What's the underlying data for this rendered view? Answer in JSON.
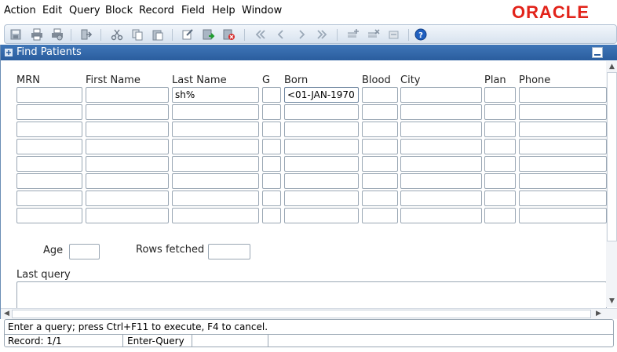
{
  "menu": [
    "Action",
    "Edit",
    "Query",
    "Block",
    "Record",
    "Field",
    "Help",
    "Window"
  ],
  "brand": "ORACLE",
  "brand_color": "#e2231a",
  "toolbar": {
    "icons": [
      "save-icon",
      "print-icon",
      "print-setup-icon",
      "exit-icon",
      "cut-icon",
      "copy-icon",
      "paste-icon",
      "enter-query-icon",
      "execute-query-icon",
      "cancel-query-icon",
      "first-record-icon",
      "previous-record-icon",
      "next-record-icon",
      "last-record-icon",
      "insert-record-icon",
      "delete-record-icon",
      "clear-record-icon",
      "help-icon"
    ]
  },
  "window": {
    "title": "Find Patients",
    "columns": [
      "MRN",
      "First Name",
      "Last Name",
      "G",
      "Born",
      "Blood",
      "City",
      "Plan",
      "Phone"
    ],
    "rows": [
      [
        "",
        "",
        "sh%",
        "",
        "<01-JAN-1970",
        "",
        "",
        "",
        ""
      ],
      [
        "",
        "",
        "",
        "",
        "",
        "",
        "",
        "",
        ""
      ],
      [
        "",
        "",
        "",
        "",
        "",
        "",
        "",
        "",
        ""
      ],
      [
        "",
        "",
        "",
        "",
        "",
        "",
        "",
        "",
        ""
      ],
      [
        "",
        "",
        "",
        "",
        "",
        "",
        "",
        "",
        ""
      ],
      [
        "",
        "",
        "",
        "",
        "",
        "",
        "",
        "",
        ""
      ],
      [
        "",
        "",
        "",
        "",
        "",
        "",
        "",
        "",
        ""
      ],
      [
        "",
        "",
        "",
        "",
        "",
        "",
        "",
        "",
        ""
      ]
    ],
    "age_label": "Age",
    "age_value": "",
    "rows_fetched_label": "Rows fetched",
    "rows_fetched_value": "",
    "last_query_label": "Last query",
    "last_query_value": ""
  },
  "status": {
    "message": "Enter a query;  press Ctrl+F11 to execute, F4 to cancel.",
    "record": "Record: 1/1",
    "mode": "Enter-Query"
  },
  "colors": {
    "title_bar": "#2f66a8",
    "toolbar": "#dfe8f2"
  }
}
